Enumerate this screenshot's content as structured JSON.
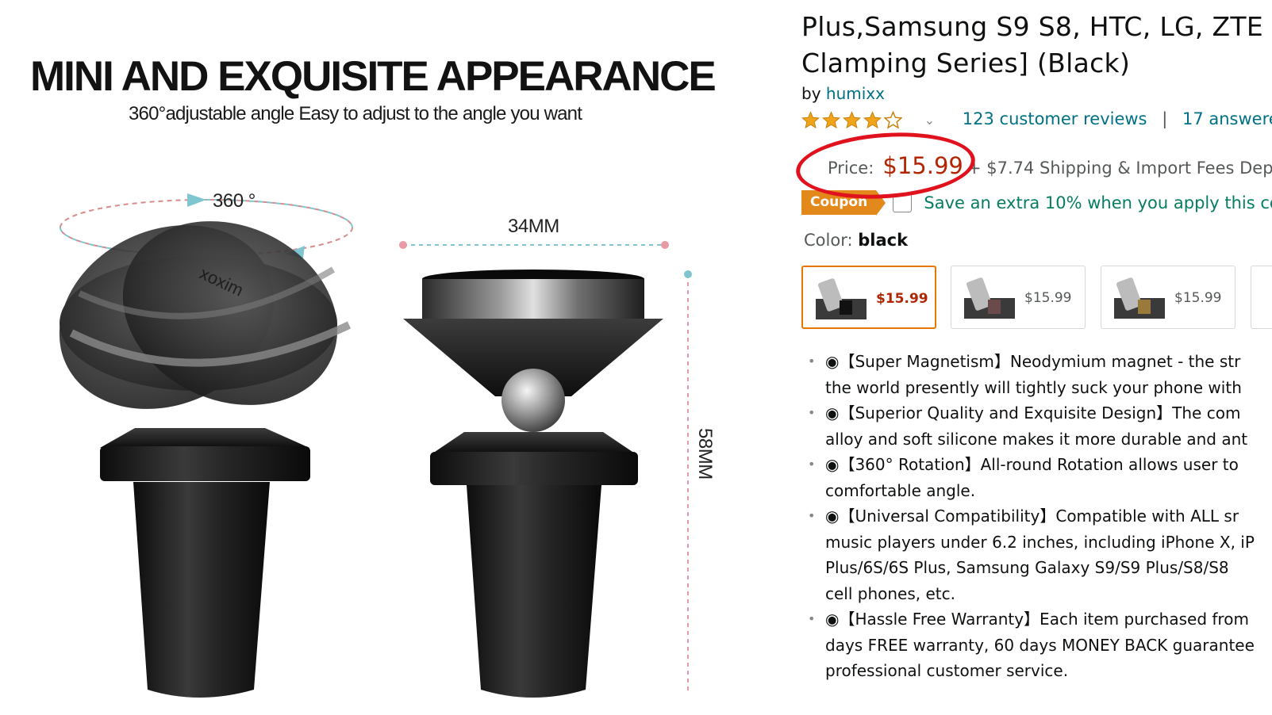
{
  "hero": {
    "title": "MINI AND EXQUISITE APPEARANCE",
    "subtitle": "360°adjustable angle Easy to adjust to the angle you want",
    "rotation_label": "360 °",
    "width_label": "34MM",
    "height_label": "58MM",
    "logo_text": "xoxim"
  },
  "product": {
    "title_lines": [
      "Plus,Samsung S9 S8, HTC, LG, ZTE",
      "Clamping Series] (Black)"
    ],
    "by_prefix": "by",
    "brand": "humixx",
    "rating": 4,
    "reviews_link": "123 customer reviews",
    "separator": "|",
    "answers_link": "17 answere",
    "price_label": "Price:",
    "price": "$15.99",
    "shipping": "+ $7.74 Shipping & Import Fees Dep",
    "coupon_badge": "Coupon",
    "coupon_text": "Save an extra 10% when you apply this co",
    "color_label": "Color:",
    "color_value": "black",
    "swatches": [
      {
        "price": "$15.99",
        "selected": true
      },
      {
        "price": "$15.99",
        "selected": false
      },
      {
        "price": "$15.99",
        "selected": false
      }
    ],
    "bullets": [
      [
        "◉【Super Magnetism】Neodymium magnet - the str",
        "the world presently will tightly suck your phone with"
      ],
      [
        "◉【Superior Quality and Exquisite Design】The com",
        "alloy and soft silicone makes it more durable and ant"
      ],
      [
        "◉【360° Rotation】All-round Rotation allows user to",
        "comfortable angle."
      ],
      [
        "◉【Universal Compatibility】Compatible with ALL sr",
        "music players under 6.2 inches, including iPhone X, iP",
        "Plus/6S/6S Plus, Samsung Galaxy S9/S9 Plus/S8/S8",
        "cell phones, etc."
      ],
      [
        "◉【Hassle Free Warranty】Each item purchased from",
        "days FREE warranty, 60 days MONEY BACK guarantee",
        "professional customer service."
      ]
    ]
  },
  "colors": {
    "price_red": "#b12704",
    "link_teal": "#007185",
    "coupon_orange": "#e3891b",
    "coupon_green": "#067d62",
    "annotation_red": "#e0121d",
    "star_gold": "#f0a41c"
  }
}
